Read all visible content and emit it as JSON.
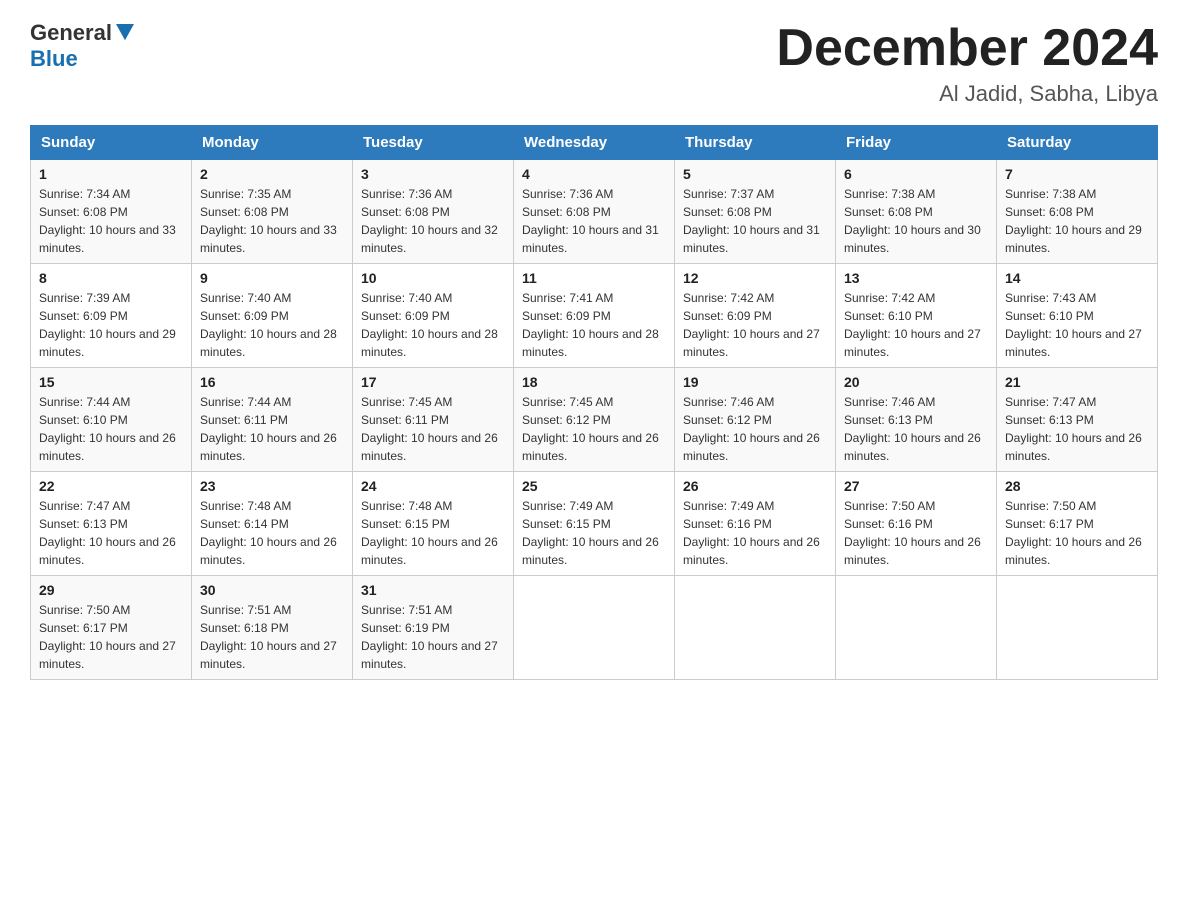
{
  "header": {
    "logo_general": "General",
    "logo_blue": "Blue",
    "month_year": "December 2024",
    "location": "Al Jadid, Sabha, Libya"
  },
  "days_of_week": [
    "Sunday",
    "Monday",
    "Tuesday",
    "Wednesday",
    "Thursday",
    "Friday",
    "Saturday"
  ],
  "weeks": [
    [
      {
        "day": "1",
        "sunrise": "7:34 AM",
        "sunset": "6:08 PM",
        "daylight": "10 hours and 33 minutes."
      },
      {
        "day": "2",
        "sunrise": "7:35 AM",
        "sunset": "6:08 PM",
        "daylight": "10 hours and 33 minutes."
      },
      {
        "day": "3",
        "sunrise": "7:36 AM",
        "sunset": "6:08 PM",
        "daylight": "10 hours and 32 minutes."
      },
      {
        "day": "4",
        "sunrise": "7:36 AM",
        "sunset": "6:08 PM",
        "daylight": "10 hours and 31 minutes."
      },
      {
        "day": "5",
        "sunrise": "7:37 AM",
        "sunset": "6:08 PM",
        "daylight": "10 hours and 31 minutes."
      },
      {
        "day": "6",
        "sunrise": "7:38 AM",
        "sunset": "6:08 PM",
        "daylight": "10 hours and 30 minutes."
      },
      {
        "day": "7",
        "sunrise": "7:38 AM",
        "sunset": "6:08 PM",
        "daylight": "10 hours and 29 minutes."
      }
    ],
    [
      {
        "day": "8",
        "sunrise": "7:39 AM",
        "sunset": "6:09 PM",
        "daylight": "10 hours and 29 minutes."
      },
      {
        "day": "9",
        "sunrise": "7:40 AM",
        "sunset": "6:09 PM",
        "daylight": "10 hours and 28 minutes."
      },
      {
        "day": "10",
        "sunrise": "7:40 AM",
        "sunset": "6:09 PM",
        "daylight": "10 hours and 28 minutes."
      },
      {
        "day": "11",
        "sunrise": "7:41 AM",
        "sunset": "6:09 PM",
        "daylight": "10 hours and 28 minutes."
      },
      {
        "day": "12",
        "sunrise": "7:42 AM",
        "sunset": "6:09 PM",
        "daylight": "10 hours and 27 minutes."
      },
      {
        "day": "13",
        "sunrise": "7:42 AM",
        "sunset": "6:10 PM",
        "daylight": "10 hours and 27 minutes."
      },
      {
        "day": "14",
        "sunrise": "7:43 AM",
        "sunset": "6:10 PM",
        "daylight": "10 hours and 27 minutes."
      }
    ],
    [
      {
        "day": "15",
        "sunrise": "7:44 AM",
        "sunset": "6:10 PM",
        "daylight": "10 hours and 26 minutes."
      },
      {
        "day": "16",
        "sunrise": "7:44 AM",
        "sunset": "6:11 PM",
        "daylight": "10 hours and 26 minutes."
      },
      {
        "day": "17",
        "sunrise": "7:45 AM",
        "sunset": "6:11 PM",
        "daylight": "10 hours and 26 minutes."
      },
      {
        "day": "18",
        "sunrise": "7:45 AM",
        "sunset": "6:12 PM",
        "daylight": "10 hours and 26 minutes."
      },
      {
        "day": "19",
        "sunrise": "7:46 AM",
        "sunset": "6:12 PM",
        "daylight": "10 hours and 26 minutes."
      },
      {
        "day": "20",
        "sunrise": "7:46 AM",
        "sunset": "6:13 PM",
        "daylight": "10 hours and 26 minutes."
      },
      {
        "day": "21",
        "sunrise": "7:47 AM",
        "sunset": "6:13 PM",
        "daylight": "10 hours and 26 minutes."
      }
    ],
    [
      {
        "day": "22",
        "sunrise": "7:47 AM",
        "sunset": "6:13 PM",
        "daylight": "10 hours and 26 minutes."
      },
      {
        "day": "23",
        "sunrise": "7:48 AM",
        "sunset": "6:14 PM",
        "daylight": "10 hours and 26 minutes."
      },
      {
        "day": "24",
        "sunrise": "7:48 AM",
        "sunset": "6:15 PM",
        "daylight": "10 hours and 26 minutes."
      },
      {
        "day": "25",
        "sunrise": "7:49 AM",
        "sunset": "6:15 PM",
        "daylight": "10 hours and 26 minutes."
      },
      {
        "day": "26",
        "sunrise": "7:49 AM",
        "sunset": "6:16 PM",
        "daylight": "10 hours and 26 minutes."
      },
      {
        "day": "27",
        "sunrise": "7:50 AM",
        "sunset": "6:16 PM",
        "daylight": "10 hours and 26 minutes."
      },
      {
        "day": "28",
        "sunrise": "7:50 AM",
        "sunset": "6:17 PM",
        "daylight": "10 hours and 26 minutes."
      }
    ],
    [
      {
        "day": "29",
        "sunrise": "7:50 AM",
        "sunset": "6:17 PM",
        "daylight": "10 hours and 27 minutes."
      },
      {
        "day": "30",
        "sunrise": "7:51 AM",
        "sunset": "6:18 PM",
        "daylight": "10 hours and 27 minutes."
      },
      {
        "day": "31",
        "sunrise": "7:51 AM",
        "sunset": "6:19 PM",
        "daylight": "10 hours and 27 minutes."
      },
      null,
      null,
      null,
      null
    ]
  ],
  "labels": {
    "sunrise_prefix": "Sunrise: ",
    "sunset_prefix": "Sunset: ",
    "daylight_prefix": "Daylight: "
  }
}
